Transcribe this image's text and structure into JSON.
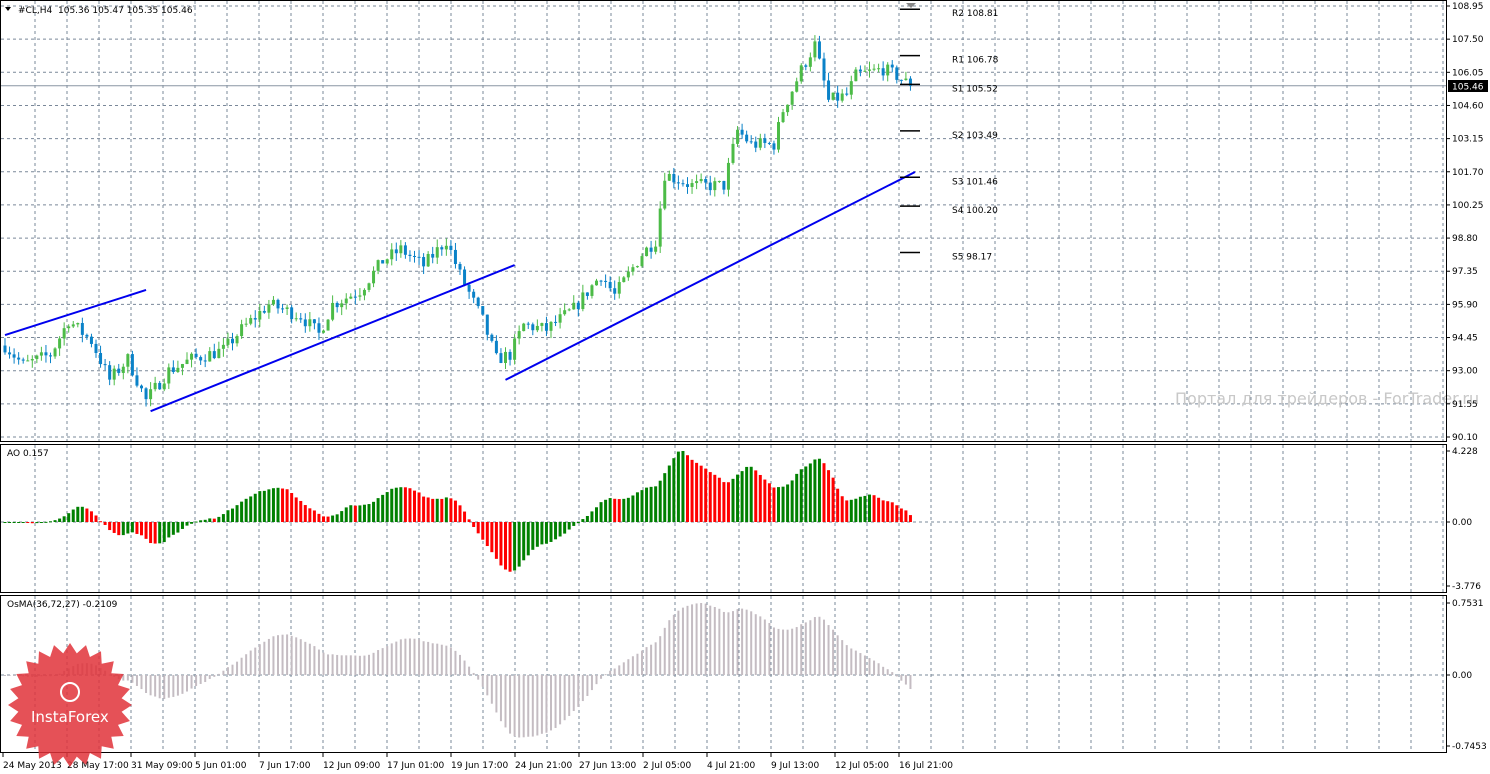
{
  "header": {
    "symbol": "#CL,H4",
    "ohlc": "105.36 105.47 105.35 105.46"
  },
  "current_price": "105.46",
  "watermark": "Портал для трейдеров - ForTrader.ru",
  "logo_text": "InstaForex",
  "colors": {
    "bull": "#4cbb47",
    "bear": "#0a82c8",
    "trend": "#0000ee",
    "ao_up": "#008000",
    "ao_down": "#ff0000",
    "osma": "#c4bcc2",
    "grid": "#7a8899"
  },
  "chart_data": [
    {
      "type": "candlestick",
      "title": "#CL,H4",
      "ylim": [
        90.1,
        108.95
      ],
      "price_ticks": [
        "108.95",
        "107.50",
        "106.05",
        "104.60",
        "103.15",
        "101.70",
        "100.25",
        "98.80",
        "97.35",
        "95.90",
        "94.45",
        "93.00",
        "91.55",
        "90.10"
      ],
      "time_labels": [
        "24 May 2013",
        "28 May 17:00",
        "31 May 09:00",
        "5 Jun 01:00",
        "7 Jun 17:00",
        "12 Jun 09:00",
        "17 Jun 01:00",
        "19 Jun 17:00",
        "24 Jun 21:00",
        "27 Jun 13:00",
        "2 Jul 05:00",
        "4 Jul 21:00",
        "9 Jul 13:00",
        "12 Jul 05:00",
        "16 Jul 21:00"
      ],
      "candle_count": 200,
      "close_path": [
        [
          0,
          94.1
        ],
        [
          4,
          93.25
        ],
        [
          10,
          93.7
        ],
        [
          14,
          95.2
        ],
        [
          19,
          94.3
        ],
        [
          23,
          92.6
        ],
        [
          27,
          93.5
        ],
        [
          31,
          91.7
        ],
        [
          36,
          93.0
        ],
        [
          41,
          93.5
        ],
        [
          48,
          93.9
        ],
        [
          52,
          94.8
        ],
        [
          58,
          95.9
        ],
        [
          65,
          95.4
        ],
        [
          69,
          94.6
        ],
        [
          72,
          95.9
        ],
        [
          78,
          96.5
        ],
        [
          83,
          97.8
        ],
        [
          87,
          98.3
        ],
        [
          92,
          97.6
        ],
        [
          97,
          98.7
        ],
        [
          100,
          97.2
        ],
        [
          105,
          95.2
        ],
        [
          108,
          93.5
        ],
        [
          111,
          93.7
        ],
        [
          114,
          95.0
        ],
        [
          119,
          94.8
        ],
        [
          125,
          95.7
        ],
        [
          131,
          97.2
        ],
        [
          134,
          96.3
        ],
        [
          140,
          98.1
        ],
        [
          143,
          98.7
        ],
        [
          145,
          101.6
        ],
        [
          151,
          101.1
        ],
        [
          158,
          101.1
        ],
        [
          161,
          103.5
        ],
        [
          164,
          102.9
        ],
        [
          169,
          102.9
        ],
        [
          171,
          104.4
        ],
        [
          175,
          106.15
        ],
        [
          178,
          107.25
        ],
        [
          181,
          104.8
        ],
        [
          185,
          105.05
        ],
        [
          187,
          105.9
        ],
        [
          193,
          106.2
        ],
        [
          196,
          105.9
        ],
        [
          199,
          105.46
        ]
      ],
      "trendlines": [
        {
          "from": [
            0,
            94.56
          ],
          "to": [
            31,
            96.53
          ]
        },
        {
          "from": [
            32,
            91.23
          ],
          "to": [
            112,
            97.62
          ]
        },
        {
          "from": [
            110,
            92.6
          ],
          "to": [
            200,
            101.69
          ]
        }
      ],
      "pivots": [
        {
          "label": "R2",
          "value": "108.81"
        },
        {
          "label": "R1",
          "value": "106.78"
        },
        {
          "label": "S1",
          "value": "105.52"
        },
        {
          "label": "S2",
          "value": "103.49"
        },
        {
          "label": "S3",
          "value": "101.46"
        },
        {
          "label": "S4",
          "value": "100.20"
        },
        {
          "label": "S5",
          "value": "98.17"
        }
      ]
    },
    {
      "type": "bar",
      "title": "AO 0.157",
      "ticks": [
        "4.228",
        "0.00",
        "-3.776"
      ],
      "ylim": [
        -3.776,
        4.228
      ]
    },
    {
      "type": "bar",
      "title": "OsMA(36,72,27) -0.2109",
      "ticks": [
        "0.7531",
        "0.00",
        "-0.7453"
      ],
      "ylim": [
        -0.7453,
        0.7531
      ]
    }
  ]
}
